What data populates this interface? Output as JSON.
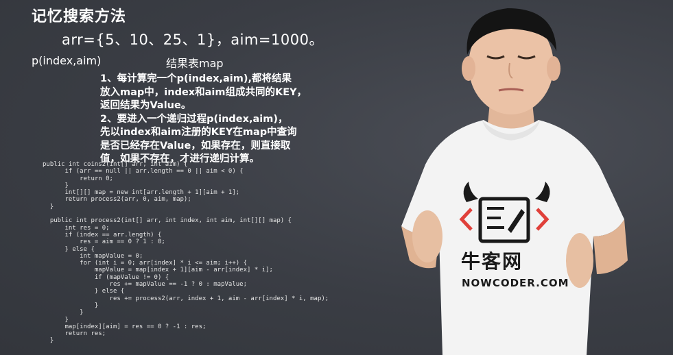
{
  "slide": {
    "title": "记忆搜索方法",
    "arr_line": "arr={5、10、25、1}，aim=1000。",
    "p_label": "p(index,aim)",
    "map_label": "结果表map",
    "notes": [
      "1、每计算完一个p(index,aim),都将结果",
      "放入map中，index和aim组成共同的KEY，",
      "返回结果为Value。",
      "2、要进入一个递归过程p(index,aim)，",
      "先以index和aim注册的KEY在map中查询",
      "是否已经存在Value，如果存在，则直接取",
      "值，如果不存在，才进行递归计算。"
    ],
    "code": [
      "public int coins2(int[] arr, int aim) {",
      "      if (arr == null || arr.length == 0 || aim < 0) {",
      "          return 0;",
      "      }",
      "      int[][] map = new int[arr.length + 1][aim + 1];",
      "      return process2(arr, 0, aim, map);",
      "  }",
      "",
      "  public int process2(int[] arr, int index, int aim, int[][] map) {",
      "      int res = 0;",
      "      if (index == arr.length) {",
      "          res = aim == 0 ? 1 : 0;",
      "      } else {",
      "          int mapValue = 0;",
      "          for (int i = 0; arr[index] * i <= aim; i++) {",
      "              mapValue = map[index + 1][aim - arr[index] * i];",
      "              if (mapValue != 0) {",
      "                  res += mapValue == -1 ? 0 : mapValue;",
      "              } else {",
      "                  res += process2(arr, index + 1, aim - arr[index] * i, map);",
      "              }",
      "          }",
      "      }",
      "      map[index][aim] = res == 0 ? -1 : res;",
      "      return res;",
      "  }"
    ]
  },
  "presenter": {
    "shirt_brand": "牛客网",
    "shirt_url": "NOWCODER.COM",
    "shirt_logo_code": "</>"
  },
  "colors": {
    "background": "#3b3e45",
    "text": "#ffffff",
    "shirt": "#f3f3f3",
    "logo": "#1a1a1a"
  }
}
